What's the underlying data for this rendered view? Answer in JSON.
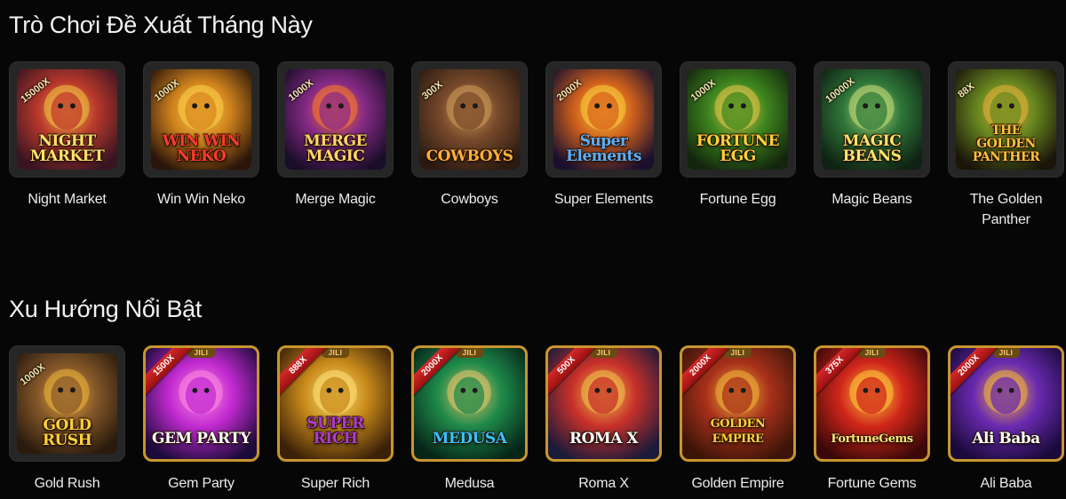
{
  "sections": [
    {
      "title": "Trò Chơi Đề Xuất Tháng Này",
      "games": [
        {
          "name": "Night Market",
          "logo": "NIGHT\nMARKET",
          "multiplier": "15000X",
          "colors": [
            "#3a1422",
            "#c0392b",
            "#f6c443"
          ],
          "logo_color": "#ffe26a"
        },
        {
          "name": "Win Win Neko",
          "logo": "WIN WIN\nNEKO",
          "multiplier": "1000X",
          "colors": [
            "#2a1408",
            "#d8871c",
            "#ffd24a"
          ],
          "logo_color": "#ff3b2f"
        },
        {
          "name": "Merge Magic",
          "logo": "MERGE\nMAGIC",
          "multiplier": "1000X",
          "colors": [
            "#1a0c2a",
            "#8a2a8a",
            "#ff7a2a"
          ],
          "logo_color": "#ffd66a"
        },
        {
          "name": "Cowboys",
          "logo": "COWBOYS",
          "multiplier": "300X",
          "colors": [
            "#2c1a10",
            "#7a4a2a",
            "#d09a5a"
          ],
          "logo_color": "#ffb03a"
        },
        {
          "name": "Super Elements",
          "logo": "Super\nElements",
          "multiplier": "2000X",
          "colors": [
            "#1a0f2e",
            "#d8631c",
            "#ffd23a"
          ],
          "logo_color": "#5ab0ff"
        },
        {
          "name": "Fortune Egg",
          "logo": "FORTUNE\nEGG",
          "multiplier": "1000X",
          "colors": [
            "#12260c",
            "#3f8a1e",
            "#e8c84a"
          ],
          "logo_color": "#ffd23a"
        },
        {
          "name": "Magic Beans",
          "logo": "MAGIC\nBEANS",
          "multiplier": "10000X",
          "colors": [
            "#0e2212",
            "#2f7a3a",
            "#c9e07a"
          ],
          "logo_color": "#ffe46a"
        },
        {
          "name": "The Golden Panther",
          "logo": "THE\nGOLDEN\nPANTHER",
          "multiplier": "88X",
          "colors": [
            "#1a1408",
            "#6a8a1e",
            "#e6b43a"
          ],
          "logo_color": "#ffc23a"
        }
      ]
    },
    {
      "title": "Xu Hướng Nổi Bật",
      "games": [
        {
          "name": "Gold Rush",
          "logo": "GOLD\nRUSH",
          "multiplier": "1000X",
          "colors": [
            "#2a1a0c",
            "#8a5a2a",
            "#f0b43a"
          ],
          "logo_color": "#ffd23a"
        },
        {
          "name": "Gem Party",
          "logo": "GEM PARTY",
          "multiplier": "1500X",
          "colors": [
            "#1c0a3a",
            "#c12ad0",
            "#ff8ae0"
          ],
          "logo_color": "#ffffff",
          "brand": "JILI"
        },
        {
          "name": "Super Rich",
          "logo": "SUPER\nRICH",
          "multiplier": "888X",
          "colors": [
            "#3a2008",
            "#c88a1a",
            "#ffe27a"
          ],
          "logo_color": "#b03ad0",
          "brand": "JILI"
        },
        {
          "name": "Medusa",
          "logo": "MEDUSA",
          "multiplier": "2000X",
          "colors": [
            "#062418",
            "#1e8a4a",
            "#e8c46a"
          ],
          "logo_color": "#3ac0ff",
          "brand": "JILI"
        },
        {
          "name": "Roma X",
          "logo": "ROMA X",
          "multiplier": "500X",
          "colors": [
            "#1a1a3a",
            "#c8302a",
            "#f0c44a"
          ],
          "logo_color": "#ffffff",
          "brand": "JILI"
        },
        {
          "name": "Golden Empire",
          "logo": "GOLDEN EMPIRE",
          "multiplier": "2000X",
          "colors": [
            "#3a1408",
            "#a8301a",
            "#f0b43a"
          ],
          "logo_color": "#ffd23a",
          "brand": "JILI"
        },
        {
          "name": "Fortune Gems",
          "logo": "FortuneGems",
          "multiplier": "375X",
          "colors": [
            "#3a0808",
            "#d0261a",
            "#ffcb3a"
          ],
          "logo_color": "#ffe27a",
          "brand": "JILI"
        },
        {
          "name": "Ali Baba",
          "logo": "Ali Baba",
          "multiplier": "2000X",
          "colors": [
            "#1a0a3a",
            "#6a2ab0",
            "#f0b43a"
          ],
          "logo_color": "#ffffff",
          "brand": "JILI"
        }
      ]
    }
  ]
}
